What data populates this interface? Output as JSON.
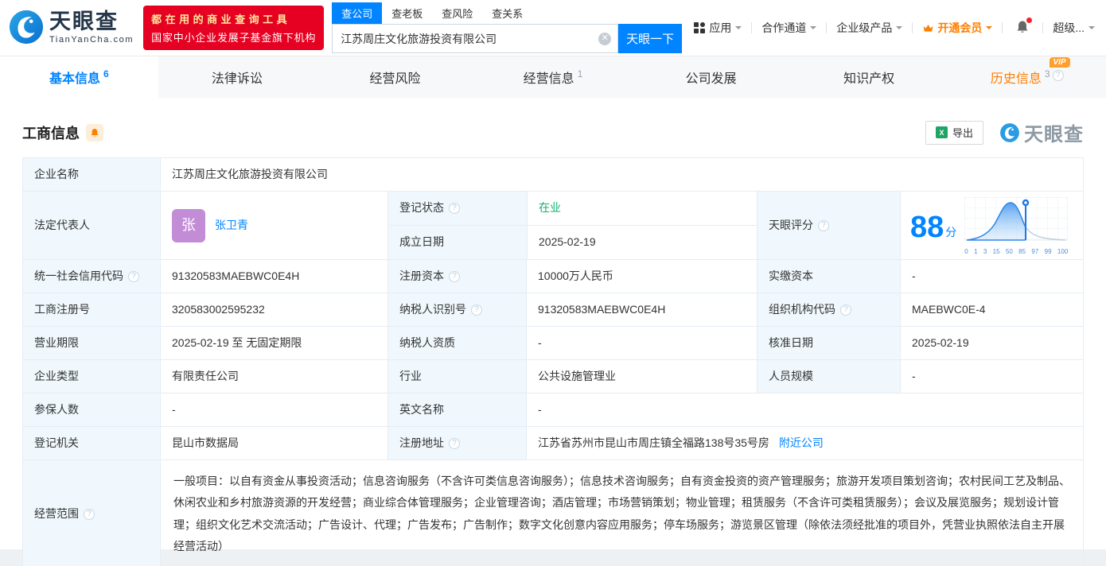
{
  "header": {
    "brand": "天眼查",
    "brand_domain": "TianYanCha.com",
    "banner_line1": "都在用的商业查询工具",
    "banner_line2": "国家中小企业发展子基金旗下机构",
    "search_tabs": [
      {
        "label": "查公司",
        "active": true
      },
      {
        "label": "查老板",
        "active": false
      },
      {
        "label": "查风险",
        "active": false
      },
      {
        "label": "查关系",
        "active": false
      }
    ],
    "search_value": "江苏周庄文化旅游投资有限公司",
    "search_button": "天眼一下",
    "nav_apps": "应用",
    "nav_partner": "合作通道",
    "nav_enterprise": "企业级产品",
    "nav_member": "开通会员",
    "nav_super": "超级..."
  },
  "tabs": [
    {
      "label": "基本信息",
      "count": "6",
      "active": true
    },
    {
      "label": "法律诉讼",
      "count": ""
    },
    {
      "label": "经营风险",
      "count": ""
    },
    {
      "label": "经营信息",
      "count": "1"
    },
    {
      "label": "公司发展",
      "count": ""
    },
    {
      "label": "知识产权",
      "count": ""
    },
    {
      "label": "历史信息",
      "count": "3",
      "badge": "VIP"
    }
  ],
  "section": {
    "title": "工商信息",
    "export_label": "导出",
    "watermark_brand": "天眼查"
  },
  "info": {
    "company_name_label": "企业名称",
    "company_name": "江苏周庄文化旅游投资有限公司",
    "legal_rep_label": "法定代表人",
    "legal_rep_avatar": "张",
    "legal_rep_name": "张卫青",
    "reg_status_label": "登记状态",
    "reg_status": "在业",
    "establish_date_label": "成立日期",
    "establish_date": "2025-02-19",
    "score_label": "天眼评分",
    "credit_code_label": "统一社会信用代码",
    "credit_code": "91320583MAEBWC0E4H",
    "reg_capital_label": "注册资本",
    "reg_capital": "10000万人民币",
    "paid_capital_label": "实缴资本",
    "paid_capital": "-",
    "reg_number_label": "工商注册号",
    "reg_number": "320583002595232",
    "taxpayer_id_label": "纳税人识别号",
    "taxpayer_id": "91320583MAEBWC0E4H",
    "org_code_label": "组织机构代码",
    "org_code": "MAEBWC0E-4",
    "business_term_label": "营业期限",
    "business_term": "2025-02-19 至 无固定期限",
    "taxpayer_quality_label": "纳税人资质",
    "taxpayer_quality": "-",
    "approval_date_label": "核准日期",
    "approval_date": "2025-02-19",
    "company_type_label": "企业类型",
    "company_type": "有限责任公司",
    "industry_label": "行业",
    "industry": "公共设施管理业",
    "staff_size_label": "人员规模",
    "staff_size": "-",
    "insured_count_label": "参保人数",
    "insured_count": "-",
    "english_name_label": "英文名称",
    "english_name": "-",
    "reg_authority_label": "登记机关",
    "reg_authority": "昆山市数据局",
    "reg_address_label": "注册地址",
    "reg_address": "江苏省苏州市昆山市周庄镇全福路138号35号房",
    "nearby_companies_link": "附近公司",
    "business_scope_label": "经营范围",
    "business_scope": "一般项目：以自有资金从事投资活动；信息咨询服务（不含许可类信息咨询服务）；信息技术咨询服务；自有资金投资的资产管理服务；旅游开发项目策划咨询；农村民间工艺及制品、休闲农业和乡村旅游资源的开发经营；商业综合体管理服务；企业管理咨询；酒店管理；市场营销策划；物业管理；租赁服务（不含许可类租赁服务）；会议及展览服务；规划设计管理；组织文化艺术交流活动；广告设计、代理；广告发布；广告制作；数字文化创意内容应用服务；停车场服务；游览景区管理（除依法须经批准的项目外，凭营业执照依法自主开展经营活动）"
  },
  "score_chart": {
    "type": "area",
    "score": "88",
    "unit": "分",
    "marker_value": 88,
    "ticks": [
      "0",
      "1",
      "3",
      "15",
      "50",
      "85",
      "97",
      "99",
      "100"
    ],
    "accent_color": "#0084ff"
  },
  "colors": {
    "primary_blue": "#0084ff",
    "orange": "#ff8000",
    "status_green": "#10b26c",
    "banner_red": "#e60021",
    "avatar_purple": "#c38cd6",
    "label_cell_bg": "#f0f8fd"
  }
}
